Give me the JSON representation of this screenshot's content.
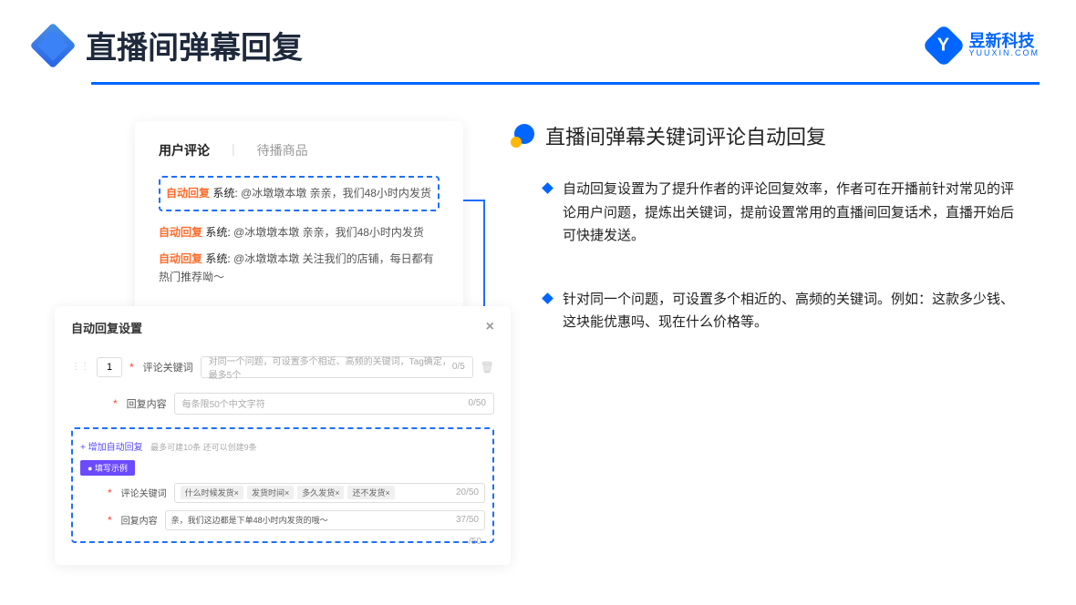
{
  "header": {
    "title": "直播间弹幕回复",
    "brand_main": "昱新科技",
    "brand_sub": "YUUXIN.COM"
  },
  "comments_card": {
    "tab_active": "用户评论",
    "tab_inactive": "待播商品",
    "replies": [
      {
        "tag": "自动回复",
        "sys": "系统:",
        "text": "@冰墩墩本墩 亲亲，我们48小时内发货"
      },
      {
        "tag": "自动回复",
        "sys": "系统:",
        "text": "@冰墩墩本墩 亲亲，我们48小时内发货"
      },
      {
        "tag": "自动回复",
        "sys": "系统:",
        "text": "@冰墩墩本墩 关注我们的店铺，每日都有热门推荐呦～"
      }
    ]
  },
  "settings_card": {
    "title": "自动回复设置",
    "index": "1",
    "label_keyword": "评论关键词",
    "placeholder_keyword": "对同一个问题，可设置多个相近、高频的关键词，Tag确定，最多5个",
    "count_keyword": "0/5",
    "label_reply": "回复内容",
    "placeholder_reply": "每条限50个中文字符",
    "count_reply": "0/50",
    "add_link": "+ 增加自动回复",
    "add_note": "最多可建10条 还可以创建9条",
    "example_badge": "● 填写示例",
    "ex_label_keyword": "评论关键词",
    "ex_tags": [
      "什么时候发货×",
      "发货时间×",
      "多久发货×",
      "还不发货×"
    ],
    "ex_keyword_count": "20/50",
    "ex_label_reply": "回复内容",
    "ex_reply_value": "亲，我们这边都是下单48小时内发货的哦～",
    "ex_reply_count": "37/50",
    "ex_outer_count": "/50"
  },
  "right": {
    "heading": "直播间弹幕关键词评论自动回复",
    "bullets": [
      "自动回复设置为了提升作者的评论回复效率，作者可在开播前针对常见的评论用户问题，提炼出关键词，提前设置常用的直播间回复话术，直播开始后可快捷发送。",
      "针对同一个问题，可设置多个相近的、高频的关键词。例如：这款多少钱、这块能优惠吗、现在什么价格等。"
    ]
  }
}
